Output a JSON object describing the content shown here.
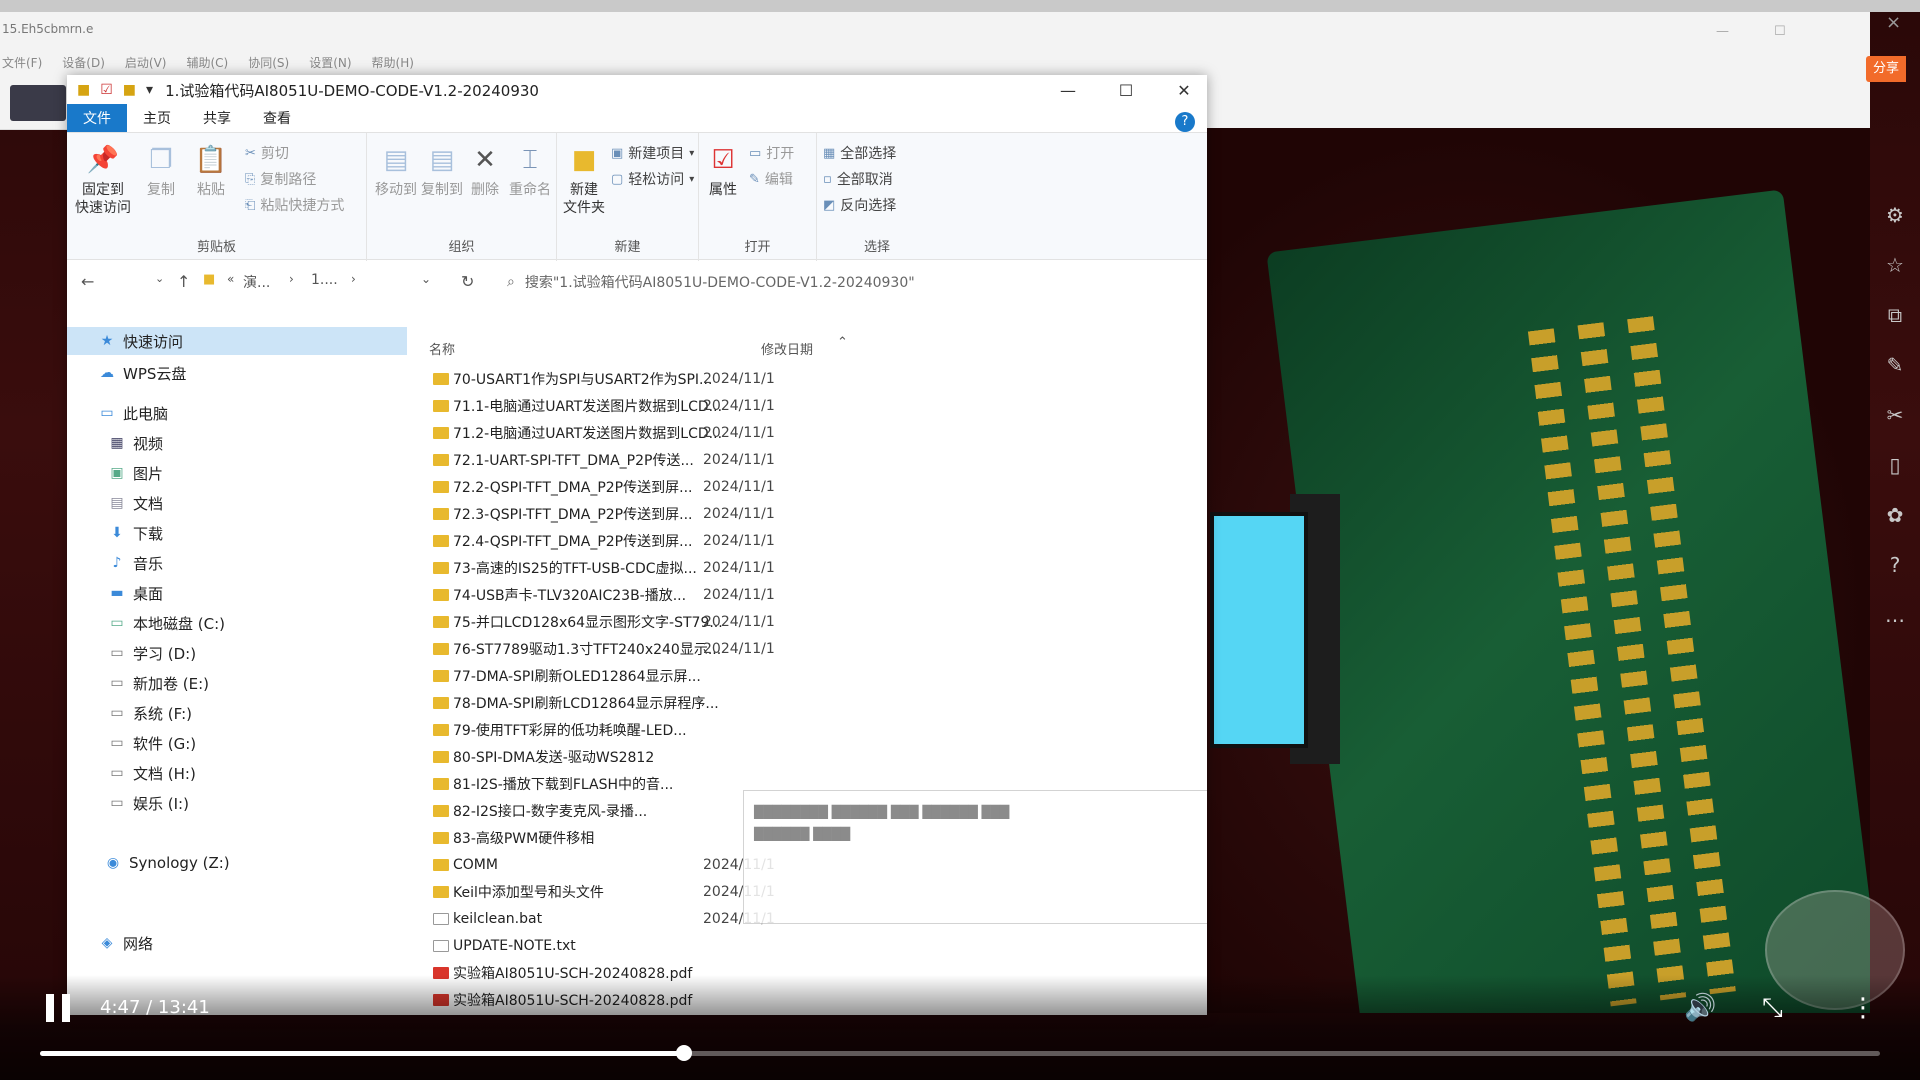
{
  "background_window": {
    "title": "15.Eh5cbmrn.e",
    "menu": [
      "文件(F)",
      "设备(D)",
      "启动(V)",
      "辅助(C)",
      "协同(S)",
      "设置(N)",
      "帮助(H)"
    ],
    "share_label": "分享"
  },
  "explorer": {
    "title": "1.试验箱代码AI8051U-DEMO-CODE-V1.2-20240930",
    "tabs": [
      "文件",
      "主页",
      "共享",
      "查看"
    ],
    "ribbon": {
      "clipboard": {
        "pin": "固定到\n快速访问",
        "copy": "复制",
        "paste": "粘贴",
        "cut": "剪切",
        "copy_path": "复制路径",
        "paste_shortcut": "粘贴快捷方式",
        "label": "剪贴板"
      },
      "organize": {
        "move_to": "移动到",
        "copy_to": "复制到",
        "delete": "删除",
        "rename": "重命名",
        "label": "组织"
      },
      "new": {
        "new_folder": "新建\n文件夹",
        "new_item": "新建项目",
        "easy_access": "轻松访问",
        "label": "新建"
      },
      "open": {
        "properties": "属性",
        "open": "打开",
        "edit": "编辑",
        "label": "打开"
      },
      "select": {
        "select_all": "全部选择",
        "select_none": "全部取消",
        "invert": "反向选择",
        "label": "选择"
      }
    },
    "address": {
      "crumb1": "演...",
      "crumb2": "1....",
      "search_placeholder": "搜索\"1.试验箱代码AI8051U-DEMO-CODE-V1.2-20240930\""
    },
    "nav": {
      "quick_access": "快速访问",
      "wps": "WPS云盘",
      "this_pc": "此电脑",
      "videos": "视频",
      "pictures": "图片",
      "documents": "文档",
      "downloads": "下载",
      "music": "音乐",
      "desktop": "桌面",
      "drive_c": "本地磁盘 (C:)",
      "drive_d": "学习 (D:)",
      "drive_e": "新加卷 (E:)",
      "drive_f": "系统 (F:)",
      "drive_g": "软件 (G:)",
      "drive_h": "文档 (H:)",
      "drive_i": "娱乐 (I:)",
      "synology": "Synology (Z:)",
      "network": "网络"
    },
    "columns": {
      "name": "名称",
      "date": "修改日期"
    },
    "files": [
      {
        "name": "70-USART1作为SPI与USART2作为SPI...",
        "date": "2024/11/1",
        "type": "folder"
      },
      {
        "name": "71.1-电脑通过UART发送图片数据到LCD...",
        "date": "2024/11/1",
        "type": "folder"
      },
      {
        "name": "71.2-电脑通过UART发送图片数据到LCD...",
        "date": "2024/11/1",
        "type": "folder"
      },
      {
        "name": "72.1-UART-SPI-TFT_DMA_P2P传送...",
        "date": "2024/11/1",
        "type": "folder"
      },
      {
        "name": "72.2-QSPI-TFT_DMA_P2P传送到屏...",
        "date": "2024/11/1",
        "type": "folder"
      },
      {
        "name": "72.3-QSPI-TFT_DMA_P2P传送到屏...",
        "date": "2024/11/1",
        "type": "folder"
      },
      {
        "name": "72.4-QSPI-TFT_DMA_P2P传送到屏...",
        "date": "2024/11/1",
        "type": "folder"
      },
      {
        "name": "73-高速的IS25的TFT-USB-CDC虚拟...",
        "date": "2024/11/1",
        "type": "folder"
      },
      {
        "name": "74-USB声卡-TLV320AIC23B-播放...",
        "date": "2024/11/1",
        "type": "folder"
      },
      {
        "name": "75-并口LCD128x64显示图形文字-ST79...",
        "date": "2024/11/1",
        "type": "folder"
      },
      {
        "name": "76-ST7789驱动1.3寸TFT240x240显示...",
        "date": "2024/11/1",
        "type": "folder"
      },
      {
        "name": "77-DMA-SPI刷新OLED12864显示屏...",
        "date": "",
        "type": "folder"
      },
      {
        "name": "78-DMA-SPI刷新LCD12864显示屏程序...",
        "date": "",
        "type": "folder"
      },
      {
        "name": "79-使用TFT彩屏的低功耗唤醒-LED...",
        "date": "",
        "type": "folder"
      },
      {
        "name": "80-SPI-DMA发送-驱动WS2812",
        "date": "",
        "type": "folder"
      },
      {
        "name": "81-I2S-播放下载到FLASH中的音...",
        "date": "",
        "type": "folder"
      },
      {
        "name": "82-I2S接口-数字麦克风-录播...",
        "date": "",
        "type": "folder"
      },
      {
        "name": "83-高级PWM硬件移相",
        "date": "",
        "type": "folder"
      },
      {
        "name": "COMM",
        "date": "2024/11/1",
        "type": "folder"
      },
      {
        "name": "Keil中添加型号和头文件",
        "date": "2024/11/1",
        "type": "folder"
      },
      {
        "name": "keilclean.bat",
        "date": "2024/11/1",
        "type": "doc"
      },
      {
        "name": "UPDATE-NOTE.txt",
        "date": "",
        "type": "doc"
      },
      {
        "name": "实验箱AI8051U-SCH-20240828.pdf",
        "date": "",
        "type": "pdf"
      },
      {
        "name": "实验箱AI8051U-SCH-20240828.pdf",
        "date": "",
        "type": "pdf"
      }
    ]
  },
  "player": {
    "time": "4:47 / 13:41",
    "progress": 0.35
  },
  "icons": [
    "pause-icon",
    "volume-icon",
    "exit-fullscreen-icon",
    "more-icon",
    "star-icon",
    "help-icon"
  ]
}
